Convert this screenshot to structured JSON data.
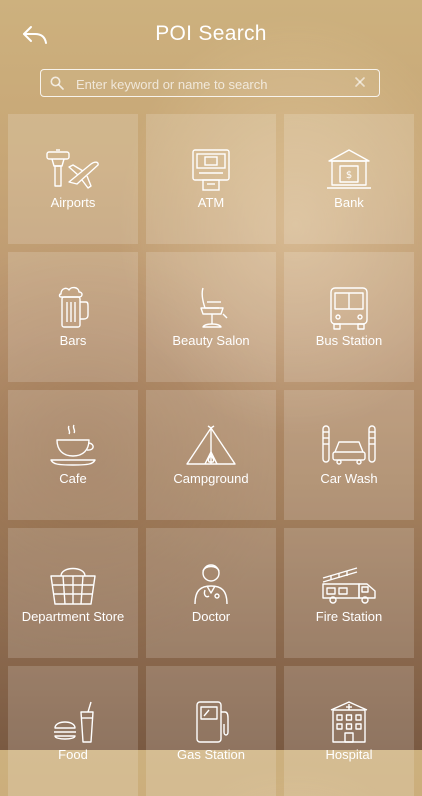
{
  "header": {
    "title": "POI Search"
  },
  "search": {
    "placeholder": "Enter keyword or name to search",
    "value": ""
  },
  "categories": [
    {
      "label": "Airports",
      "icon": "airport-icon"
    },
    {
      "label": "ATM",
      "icon": "atm-icon"
    },
    {
      "label": "Bank",
      "icon": "bank-icon"
    },
    {
      "label": "Bars",
      "icon": "beer-mug-icon"
    },
    {
      "label": "Beauty Salon",
      "icon": "salon-chair-icon"
    },
    {
      "label": "Bus Station",
      "icon": "bus-icon"
    },
    {
      "label": "Cafe",
      "icon": "coffee-cup-icon"
    },
    {
      "label": "Campground",
      "icon": "tent-icon"
    },
    {
      "label": "Car Wash",
      "icon": "car-wash-icon"
    },
    {
      "label": "Department Store",
      "icon": "basket-icon"
    },
    {
      "label": "Doctor",
      "icon": "doctor-icon"
    },
    {
      "label": "Fire Station",
      "icon": "fire-truck-icon"
    },
    {
      "label": "Food",
      "icon": "burger-drink-icon"
    },
    {
      "label": "Gas Station",
      "icon": "gas-pump-icon"
    },
    {
      "label": "Hospital",
      "icon": "hospital-icon"
    }
  ]
}
